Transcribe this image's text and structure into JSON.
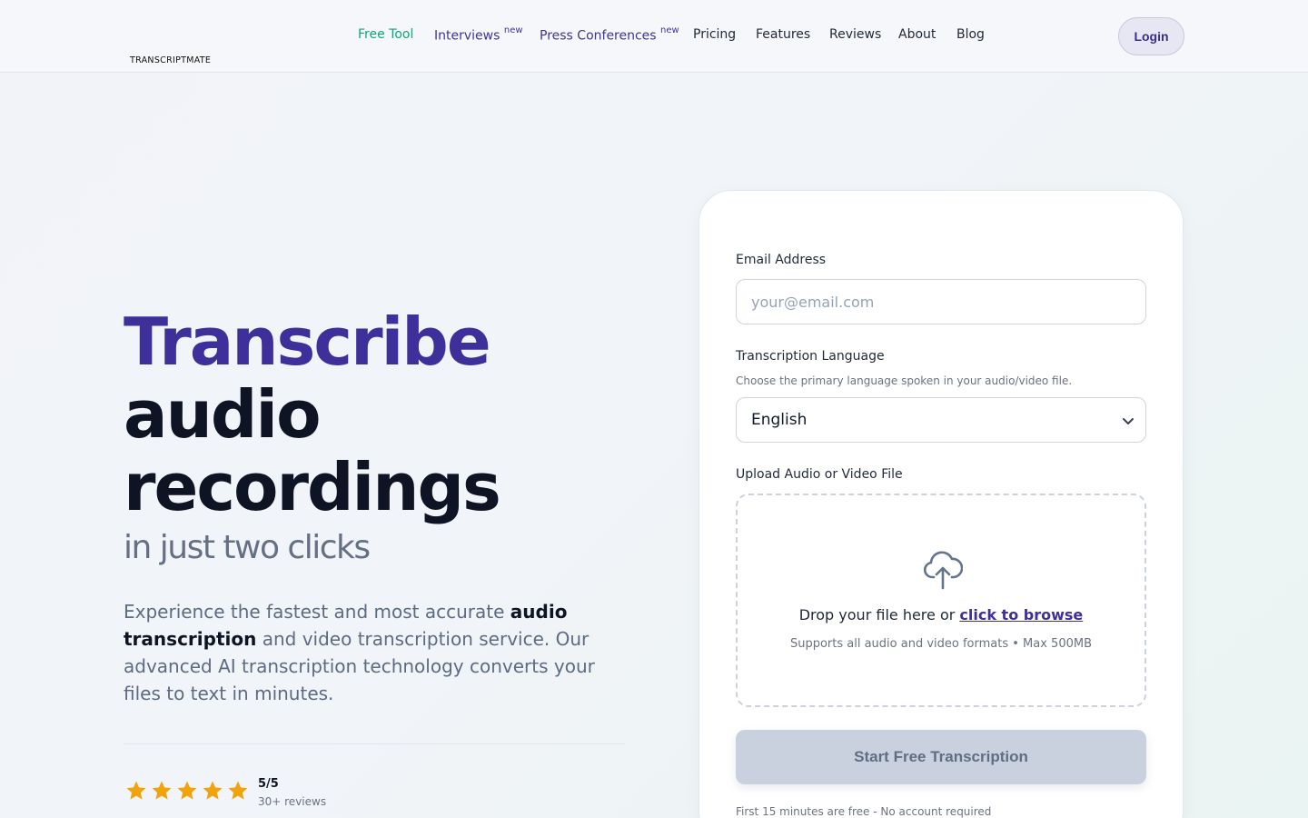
{
  "brand": {
    "name": "TRANSCRIPTMATE"
  },
  "nav": {
    "items": [
      {
        "label": "Free Tool",
        "badge": ""
      },
      {
        "label": "Interviews",
        "badge": "new"
      },
      {
        "label": "Press Conferences",
        "badge": "new"
      },
      {
        "label": "Pricing",
        "badge": ""
      },
      {
        "label": "Features",
        "badge": ""
      },
      {
        "label": "Reviews",
        "badge": ""
      },
      {
        "label": "About",
        "badge": ""
      },
      {
        "label": "Blog",
        "badge": ""
      }
    ],
    "login_label": "Login"
  },
  "hero": {
    "title_line1": "Transcribe",
    "title_line2": "audio",
    "title_line3": "recordings",
    "subtitle": "in just two clicks",
    "desc_part1": "Experience the fastest and most accurate ",
    "desc_bold": "audio transcription",
    "desc_part2": " and video transcription service. Our advanced AI transcription technology converts your files to text in minutes.",
    "rating_score": "5/5",
    "rating_count": "30+ reviews",
    "stars": 5
  },
  "form": {
    "email_label": "Email Address",
    "email_placeholder": "your@email.com",
    "language_label": "Transcription Language",
    "language_helper": "Choose the primary language spoken in your audio/video file.",
    "language_selected": "English",
    "upload_label": "Upload Audio or Video File",
    "drop_text": "Drop your file here or ",
    "browse_link": "click to browse",
    "drop_sub": "Supports all audio and video formats • Max 500MB",
    "submit_label": "Start Free Transcription",
    "footnote": "First 15 minutes are free - No account required"
  },
  "colors": {
    "accent_purple": "#3f2f9a",
    "active_nav": "#10a57e",
    "star": "#f0a30a"
  },
  "icons": [
    "logo-waveform-icon",
    "chevron-down-icon",
    "cloud-upload-icon",
    "star-icon"
  ]
}
